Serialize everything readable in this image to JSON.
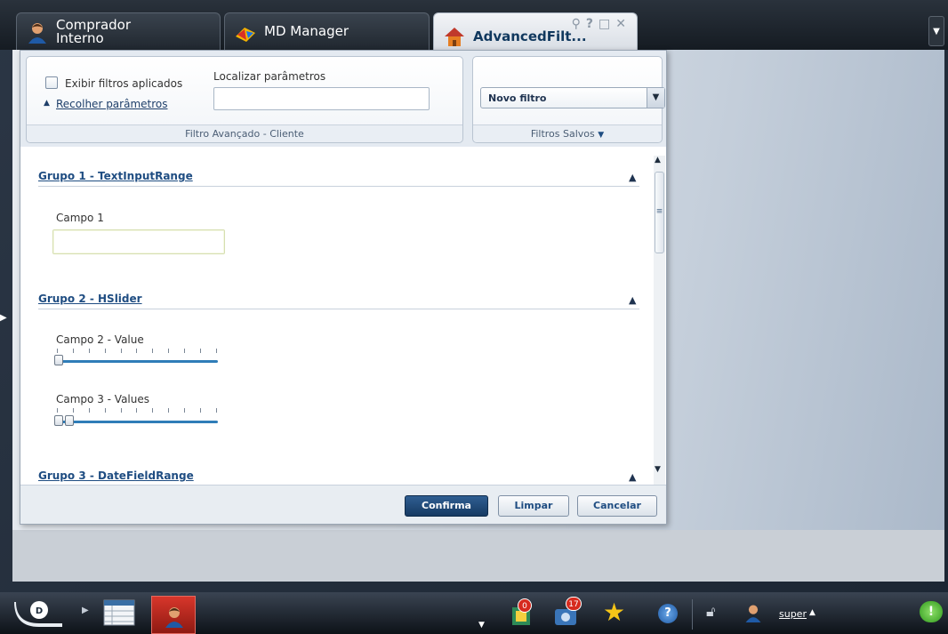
{
  "tabs": [
    {
      "label_line1": "Comprador",
      "label_line2": "Interno",
      "icon": "user-icon"
    },
    {
      "label": "MD Manager",
      "icon": "md-manager-icon"
    },
    {
      "label": "AdvancedFilt...",
      "icon": "house-icon",
      "active": true
    }
  ],
  "tab_tools": {
    "wrench": "⚲",
    "help": "?",
    "maximize": "□",
    "close": "✕"
  },
  "filter_header": {
    "show_applied_label": "Exibir filtros aplicados",
    "collapse_link": "Recolher parâmetros",
    "search_label": "Localizar parâmetros",
    "search_value": "",
    "box_footer": "Filtro Avançado - Cliente",
    "saved_filter_value": "Novo filtro",
    "saved_footer": "Filtros Salvos"
  },
  "groups": [
    {
      "title": "Grupo 1 - TextInputRange",
      "field_label": "Campo 1",
      "field_value": ""
    },
    {
      "title": "Grupo 2 - HSlider",
      "field_a_label": "Campo 2 - Value",
      "field_b_label": "Campo 3 - Values"
    },
    {
      "title": "Grupo 3 - DateFieldRange"
    }
  ],
  "sliders": {
    "campo2_value": 0,
    "campo3_values": [
      0,
      0.1
    ]
  },
  "buttons": {
    "confirm": "Confirma",
    "clear": "Limpar",
    "cancel": "Cancelar"
  },
  "taskbar": {
    "notifications_count": "0",
    "tasks_count": "17",
    "user_name": "super",
    "user_caret": "▲"
  },
  "colors": {
    "accent": "#1f4d82",
    "primary_button": "#1e4a78",
    "slider": "#2f7db8"
  }
}
